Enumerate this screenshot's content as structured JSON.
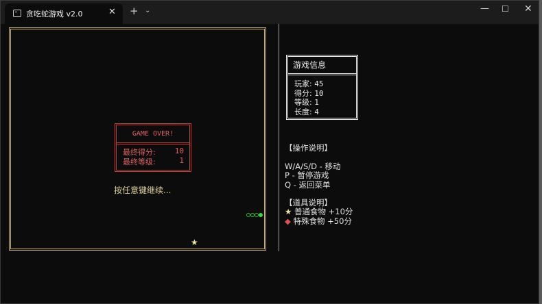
{
  "window": {
    "tab_title": "贪吃蛇游戏 v2.0",
    "tab_close": "✕",
    "new_tab": "+",
    "dropdown": "⌄",
    "minimize": "—",
    "maximize": "☐",
    "close": "✕"
  },
  "game": {
    "game_over_title": "GAME OVER!",
    "final_score_label": "最终得分:",
    "final_score_value": "10",
    "final_level_label": "最终等级:",
    "final_level_value": "1",
    "continue_text": "按任意键继续...",
    "food_glyph": "★",
    "snake_length": 4,
    "snake_color": "#38d838"
  },
  "info": {
    "title": "游戏信息",
    "rows": [
      {
        "label": "玩家:",
        "value": "45"
      },
      {
        "label": "得分:",
        "value": "10"
      },
      {
        "label": "等级:",
        "value": "1"
      },
      {
        "label": "长度:",
        "value": "4"
      }
    ]
  },
  "help": {
    "ops_heading": "【操作说明】",
    "ops": [
      "W/A/S/D - 移动",
      "P - 暂停游戏",
      "Q - 返回菜单"
    ],
    "items_heading": "【道具说明】",
    "items": [
      {
        "glyph": "★",
        "text": "普通食物 +10分",
        "color": "#f3e1a2"
      },
      {
        "glyph": "◆",
        "text": "特殊食物 +50分",
        "color": "#e05050"
      }
    ]
  },
  "colors": {
    "border_gold": "#c8b26a",
    "gameover_red": "#c23b3b",
    "background": "#0c0c0c"
  }
}
